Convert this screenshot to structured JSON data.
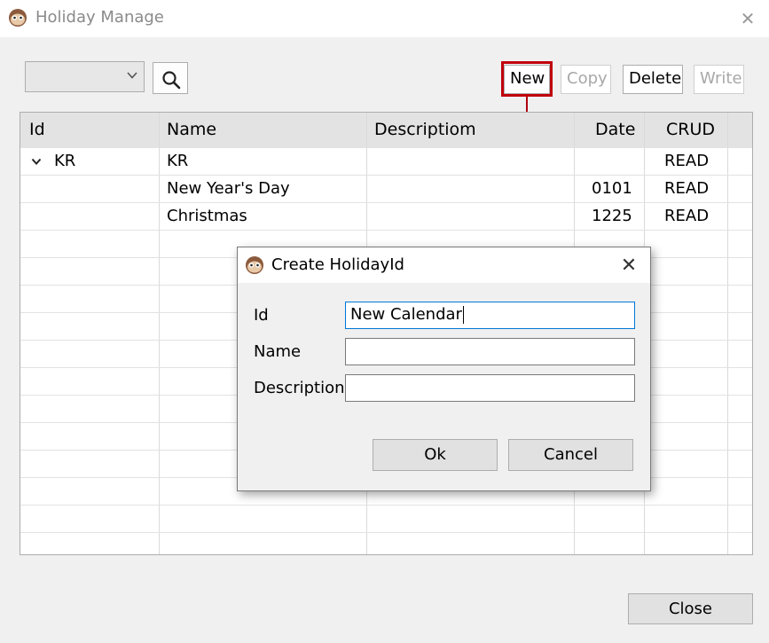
{
  "window": {
    "title": "Holiday Manage",
    "close_symbol": "✕"
  },
  "toolbar": {
    "combo_value": "",
    "new_label": "New",
    "copy_label": "Copy",
    "delete_label": "Delete",
    "write_label": "Write"
  },
  "table": {
    "columns": [
      "Id",
      "Name",
      "Descriptiom",
      "Date",
      "CRUD"
    ],
    "rows": [
      {
        "id": "KR",
        "name": "KR",
        "description": "",
        "date": "",
        "crud": "READ",
        "expand_symbol": "⌄"
      },
      {
        "id": "",
        "name": "New Year's Day",
        "description": "",
        "date": "0101",
        "crud": "READ"
      },
      {
        "id": "",
        "name": "Christmas",
        "description": "",
        "date": "1225",
        "crud": "READ"
      }
    ]
  },
  "dialog": {
    "title": "Create HolidayId",
    "close_symbol": "✕",
    "fields": {
      "id_label": "Id",
      "id_value": "New Calendar",
      "name_label": "Name",
      "name_value": "",
      "description_label": "Description",
      "description_value": ""
    },
    "ok_label": "Ok",
    "cancel_label": "Cancel"
  },
  "footer": {
    "close_label": "Close"
  },
  "colors": {
    "highlight": "#c0000a",
    "focus": "#0078d7"
  }
}
